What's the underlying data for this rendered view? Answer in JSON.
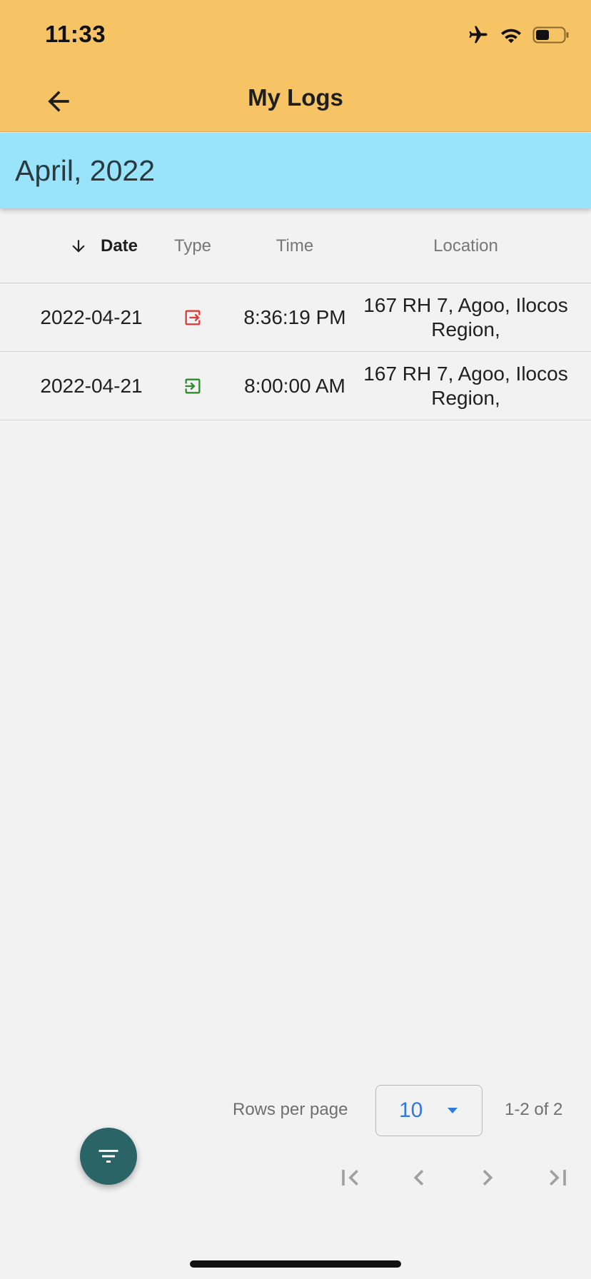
{
  "status_bar": {
    "time": "11:33",
    "icons": [
      "airplane-icon",
      "wifi-icon",
      "battery-icon"
    ]
  },
  "appbar": {
    "title": "My Logs",
    "back_icon": "arrow-left-icon",
    "color": "#f7c465"
  },
  "banner": {
    "month": "April, 2022",
    "color": "#9ae4fb"
  },
  "table": {
    "columns": [
      "Date",
      "Type",
      "Time",
      "Location"
    ],
    "sort_icon": "arrow-down-icon",
    "rows": [
      {
        "date": "2022-04-21",
        "type_icon": "logout-icon",
        "type_color": "#e03b3b",
        "time": "8:36:19 PM",
        "location": "167 RH 7, Agoo, Ilocos Region,"
      },
      {
        "date": "2022-04-21",
        "type_icon": "login-icon",
        "type_color": "#2e8b2e",
        "time": "8:00:00 AM",
        "location": "167 RH 7, Agoo, Ilocos Region,"
      }
    ]
  },
  "pagination": {
    "rows_per_page_label": "Rows per page",
    "rows_per_page_value": "10",
    "range_label": "1-2 of 2",
    "buttons": [
      "first-page-icon",
      "prev-page-icon",
      "next-page-icon",
      "last-page-icon"
    ]
  },
  "fab": {
    "icon": "filter-icon",
    "color": "#2b6467"
  }
}
